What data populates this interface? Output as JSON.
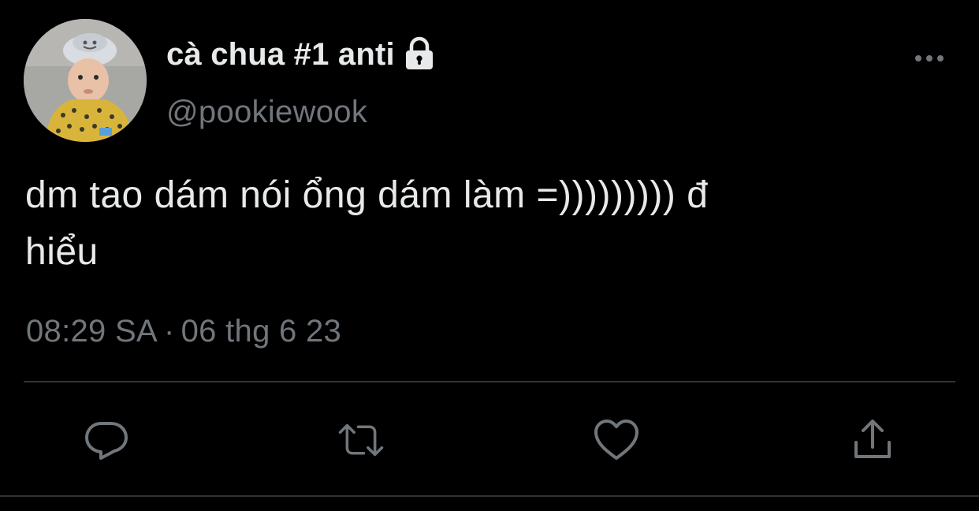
{
  "user": {
    "display_name": "cà chua #1 anti",
    "handle": "@pookiewook",
    "protected_icon": "lock-icon"
  },
  "tweet": {
    "text": "dm tao dám nói ổng dám làm =))))))))) đ\nhiểu",
    "time": "08:29 SA",
    "separator": "·",
    "date": "06 thg 6 23"
  },
  "actions": {
    "reply_icon": "reply-icon",
    "retweet_icon": "retweet-icon",
    "like_icon": "heart-icon",
    "share_icon": "share-icon",
    "more_icon": "more-icon"
  },
  "colors": {
    "background": "#000000",
    "text_primary": "#e7e9ea",
    "text_secondary": "#71767b",
    "divider": "#2f3336"
  }
}
